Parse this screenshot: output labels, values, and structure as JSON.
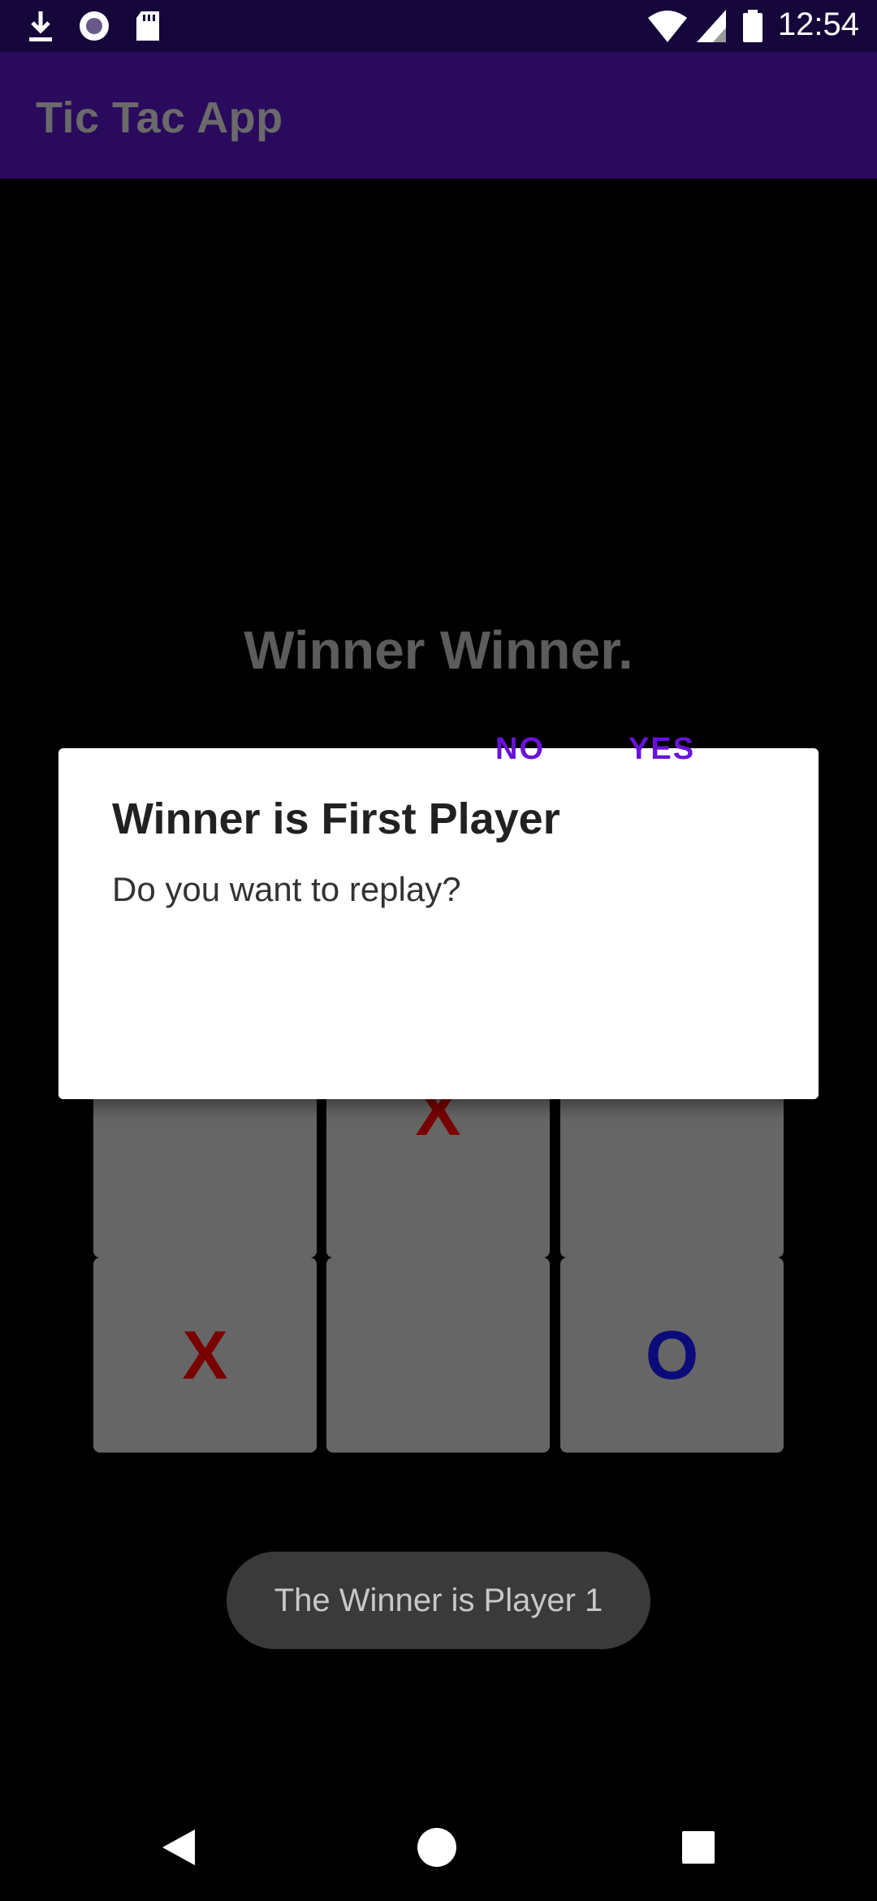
{
  "status_bar": {
    "time": "12:54",
    "icons": [
      "download-icon",
      "circle-record-icon",
      "sd-card-icon",
      "wifi-icon",
      "signal-icon",
      "battery-icon"
    ]
  },
  "app_bar": {
    "title": "Tic Tac App"
  },
  "main": {
    "heading": "Winner Winner.",
    "board": {
      "cells": [
        "",
        "X",
        "",
        "X",
        "",
        "O"
      ]
    }
  },
  "dialog": {
    "title": "Winner is First Player",
    "message": "Do you want to replay?",
    "no_label": "NO",
    "yes_label": "YES"
  },
  "toast": {
    "text": "The Winner is Player 1"
  },
  "nav_bar": {
    "icons": [
      "back-icon",
      "home-icon",
      "recents-icon"
    ]
  },
  "colors": {
    "status_bar": "#15073a",
    "app_bar": "#2a0a5c",
    "accent": "#6a11d8",
    "mark_x": "#7a0000",
    "mark_o": "#0b0b7a",
    "cell": "#666666"
  }
}
